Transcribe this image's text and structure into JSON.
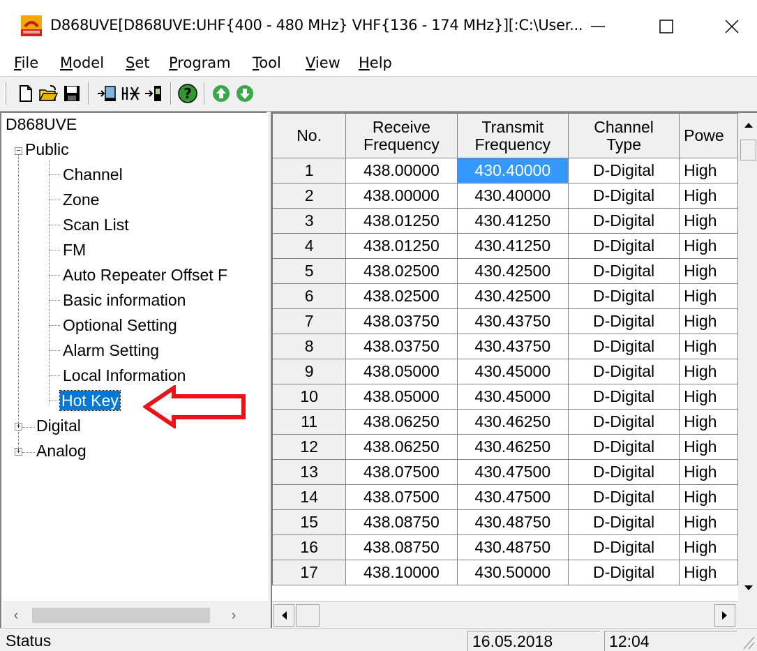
{
  "window": {
    "title": "D868UVE[D868UVE:UHF{400 - 480 MHz} VHF{136 - 174 MHz}][:C:\\User...",
    "icon": "app-logo-icon"
  },
  "menu": [
    {
      "id": "file",
      "label": "File",
      "mnemonic": "F",
      "rest": "ile"
    },
    {
      "id": "model",
      "label": "Model",
      "mnemonic": "M",
      "rest": "odel"
    },
    {
      "id": "set",
      "label": "Set",
      "mnemonic": "S",
      "rest": "et"
    },
    {
      "id": "program",
      "label": "Program",
      "mnemonic": "P",
      "rest": "rogram"
    },
    {
      "id": "tool",
      "label": "Tool",
      "mnemonic": "T",
      "rest": "ool"
    },
    {
      "id": "view",
      "label": "View",
      "mnemonic": "V",
      "rest": "iew"
    },
    {
      "id": "help",
      "label": "Help",
      "mnemonic": "H",
      "rest": "elp"
    }
  ],
  "toolbar": {
    "buttons": [
      "new-file-icon",
      "open-folder-icon",
      "save-icon",
      "read-from-radio-icon",
      "compare-icon",
      "write-to-radio-icon",
      "help-icon",
      "move-up-icon",
      "move-down-icon"
    ]
  },
  "tree": {
    "root": "D868UVE",
    "public": "Public",
    "public_children": [
      "Channel",
      "Zone",
      "Scan List",
      "FM",
      "Auto Repeater Offset F",
      "Basic information",
      "Optional Setting",
      "Alarm Setting",
      "Local Information",
      "Hot Key"
    ],
    "selected": "Hot Key",
    "digital": "Digital",
    "analog": "Analog"
  },
  "grid": {
    "headers": {
      "no": "No.",
      "rx_1": "Receive",
      "rx_2": "Frequency",
      "tx_1": "Transmit",
      "tx_2": "Frequency",
      "type_1": "Channel",
      "type_2": "Type",
      "power": "Powe"
    },
    "rows": [
      {
        "no": "1",
        "rx": "438.00000",
        "tx": "430.40000",
        "type": "D-Digital",
        "power": "High"
      },
      {
        "no": "2",
        "rx": "438.00000",
        "tx": "430.40000",
        "type": "D-Digital",
        "power": "High"
      },
      {
        "no": "3",
        "rx": "438.01250",
        "tx": "430.41250",
        "type": "D-Digital",
        "power": "High"
      },
      {
        "no": "4",
        "rx": "438.01250",
        "tx": "430.41250",
        "type": "D-Digital",
        "power": "High"
      },
      {
        "no": "5",
        "rx": "438.02500",
        "tx": "430.42500",
        "type": "D-Digital",
        "power": "High"
      },
      {
        "no": "6",
        "rx": "438.02500",
        "tx": "430.42500",
        "type": "D-Digital",
        "power": "High"
      },
      {
        "no": "7",
        "rx": "438.03750",
        "tx": "430.43750",
        "type": "D-Digital",
        "power": "High"
      },
      {
        "no": "8",
        "rx": "438.03750",
        "tx": "430.43750",
        "type": "D-Digital",
        "power": "High"
      },
      {
        "no": "9",
        "rx": "438.05000",
        "tx": "430.45000",
        "type": "D-Digital",
        "power": "High"
      },
      {
        "no": "10",
        "rx": "438.05000",
        "tx": "430.45000",
        "type": "D-Digital",
        "power": "High"
      },
      {
        "no": "11",
        "rx": "438.06250",
        "tx": "430.46250",
        "type": "D-Digital",
        "power": "High"
      },
      {
        "no": "12",
        "rx": "438.06250",
        "tx": "430.46250",
        "type": "D-Digital",
        "power": "High"
      },
      {
        "no": "13",
        "rx": "438.07500",
        "tx": "430.47500",
        "type": "D-Digital",
        "power": "High"
      },
      {
        "no": "14",
        "rx": "438.07500",
        "tx": "430.47500",
        "type": "D-Digital",
        "power": "High"
      },
      {
        "no": "15",
        "rx": "438.08750",
        "tx": "430.48750",
        "type": "D-Digital",
        "power": "High"
      },
      {
        "no": "16",
        "rx": "438.08750",
        "tx": "430.48750",
        "type": "D-Digital",
        "power": "High"
      },
      {
        "no": "17",
        "rx": "438.10000",
        "tx": "430.50000",
        "type": "D-Digital",
        "power": "High"
      }
    ]
  },
  "status": {
    "label": "Status",
    "date": "16.05.2018",
    "time": "12:04"
  },
  "colors": {
    "selection": "#0078d7",
    "cell_highlight": "#3399ff",
    "annotation": "#e8141b"
  }
}
